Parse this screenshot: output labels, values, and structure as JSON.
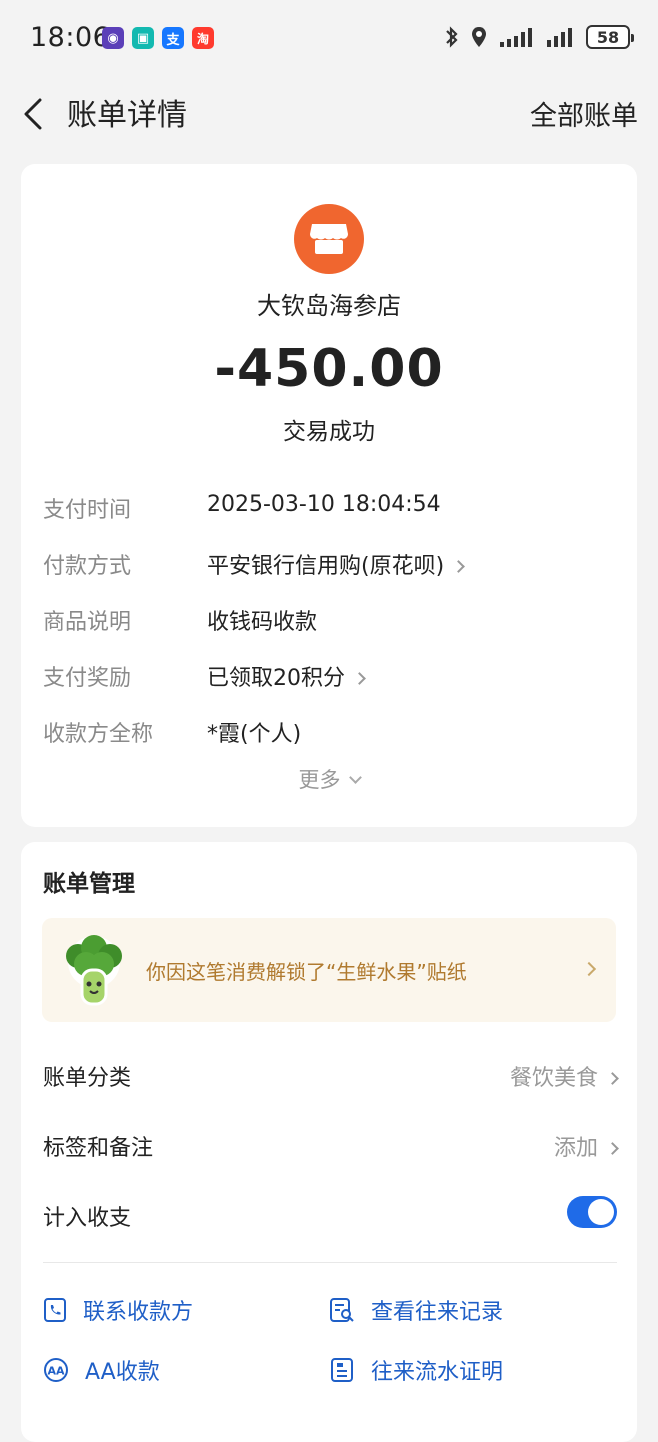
{
  "status_bar": {
    "time": "18:06",
    "battery": "58",
    "apps": [
      {
        "name": "app-icon-1",
        "color": "#5b3fb8",
        "glyph": "◉"
      },
      {
        "name": "app-icon-2",
        "color": "#13b9b0",
        "glyph": "▣"
      },
      {
        "name": "alipay-icon",
        "color": "#1677ff",
        "glyph": "支"
      },
      {
        "name": "taobao-icon",
        "color": "#ff3a2e",
        "glyph": "淘"
      }
    ]
  },
  "nav": {
    "title": "账单详情",
    "right_link": "全部账单"
  },
  "bill": {
    "merchant": "大钦岛海参店",
    "amount": "-450.00",
    "status": "交易成功",
    "details": [
      {
        "key": "支付时间",
        "value": "2025-03-10 18:04:54",
        "arrow": false
      },
      {
        "key": "付款方式",
        "value": "平安银行信用购(原花呗)",
        "arrow": true
      },
      {
        "key": "商品说明",
        "value": "收钱码收款",
        "arrow": false
      },
      {
        "key": "支付奖励",
        "value": "已领取20积分",
        "arrow": true
      },
      {
        "key": "收款方全称",
        "value": "*霞(个人)",
        "arrow": false
      }
    ],
    "more": "更多"
  },
  "management": {
    "title": "账单管理",
    "banner_text": "你因这笔消费解锁了“生鲜水果”贴纸",
    "category_label": "账单分类",
    "category_value": "餐饮美食",
    "tags_label": "标签和备注",
    "tags_value": "添加",
    "include_label": "计入收支",
    "include_on": true,
    "actions": {
      "contact": "联系收款方",
      "history": "查看往来记录",
      "aa": "AA收款",
      "proof": "往来流水证明"
    }
  },
  "colors": {
    "accent": "#1f6be8",
    "merchant_logo": "#f0662f",
    "banner_bg": "#fbf6ec",
    "banner_text": "#b07a2f"
  }
}
